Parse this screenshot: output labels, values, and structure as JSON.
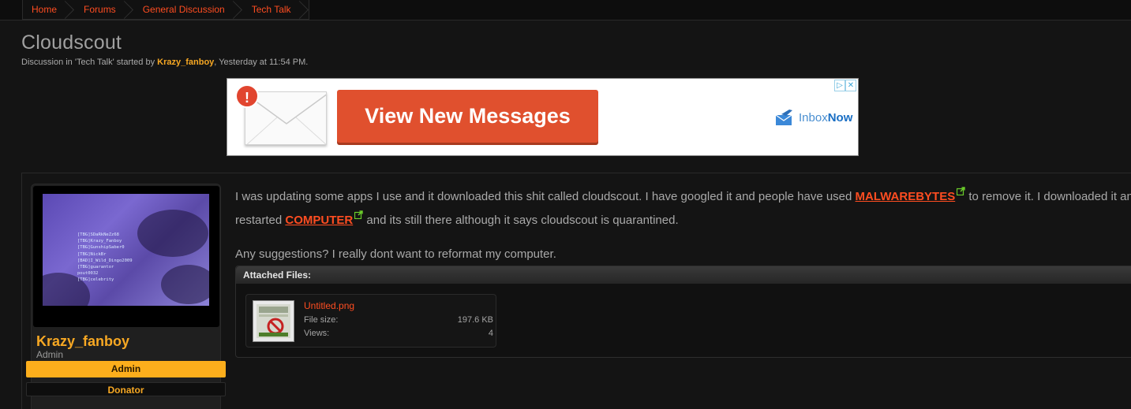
{
  "breadcrumb": [
    "Home",
    "Forums",
    "General Discussion",
    "Tech Talk"
  ],
  "thread": {
    "title": "Cloudscout",
    "desc_prefix": "Discussion in 'Tech Talk' started by ",
    "author": "Krazy_fanboy",
    "desc_suffix": ", Yesterday at 11:54 PM."
  },
  "ad": {
    "alert_symbol": "!",
    "cta_label": "View New Messages",
    "brand_prefix": "Inbox",
    "brand_bold": "Now",
    "adchoice_icons": [
      "play-triangle-icon",
      "close-icon"
    ]
  },
  "user": {
    "name": "Krazy_fanboy",
    "title": "Admin",
    "banners": [
      "Admin",
      "Donator"
    ],
    "avatar_text": [
      "[TBG]SDaRkNeZz68",
      "[TBG]Krazy_Fanboy",
      "[TBG]GunshipSaber0",
      "[TBG]NickBr",
      "[BAD]I_Wild_Dingo2009",
      "[TBG]guarantor",
      "pout0032",
      "[TBG]celebrity"
    ]
  },
  "post": {
    "line1_a": "I was updating some apps I use and it downloaded this shit called cloudscout. I have googled it and people have used ",
    "link1": "MALWAREBYTES",
    "line1_b": " to remove it. I downloaded it and restarted",
    "line2_a": "restarted ",
    "link2": "COMPUTER",
    "line2_b": " and its still there although it says cloudscout is quarantined.",
    "line3": "Any suggestions? I really dont want to reformat my computer."
  },
  "attachments": {
    "header": "Attached Files:",
    "file": {
      "name": "Untitled.png",
      "size_label": "File size:",
      "size": "197.6 KB",
      "views_label": "Views:",
      "views": "4"
    }
  },
  "colors": {
    "accent": "#ff4d21",
    "username": "#f7a823",
    "banner_admin": "#fcae1c",
    "background": "#141414",
    "ad_button": "#e0502e"
  }
}
